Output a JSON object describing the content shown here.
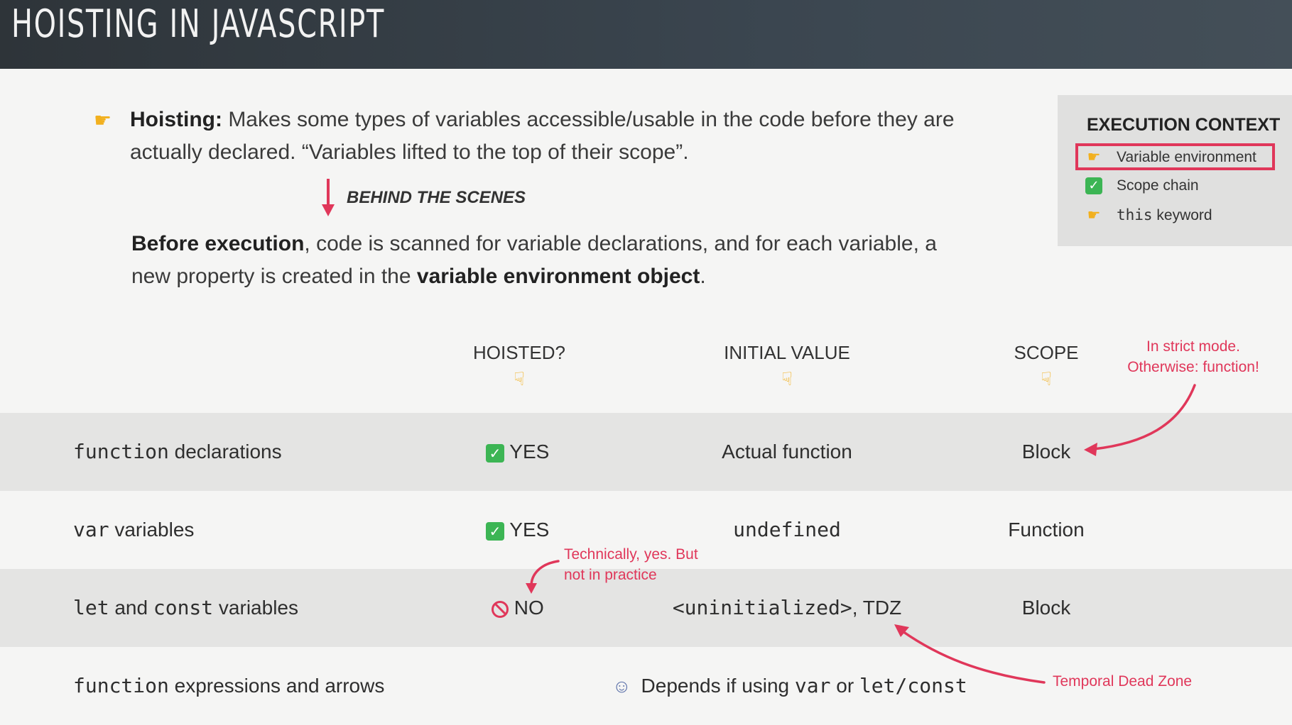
{
  "header": {
    "title": "HOISTING IN JAVASCRIPT"
  },
  "intro": {
    "term": "Hoisting:",
    "text": " Makes some types of variables accessible/usable in the code before they are actually declared. “Variables lifted to the top of their scope”."
  },
  "behind_label": "BEHIND THE SCENES",
  "before": {
    "bold1": "Before execution",
    "text1": ", code is scanned for variable declarations, and for each variable, a new property is created in the ",
    "bold2": "variable environment object",
    "text2": "."
  },
  "execution_context": {
    "title": "EXECUTION CONTEXT",
    "items": [
      {
        "label": "Variable environment",
        "icon": "pointing-hand-icon",
        "highlighted": true
      },
      {
        "label": "Scope chain",
        "icon": "check-icon"
      },
      {
        "label_code": "this",
        "label": " keyword",
        "icon": "pointing-hand-icon"
      }
    ]
  },
  "columns": {
    "hoisted": "HOISTED?",
    "initial": "INITIAL VALUE",
    "scope": "SCOPE"
  },
  "rows": [
    {
      "code": "function",
      "text": " declarations",
      "hoisted": "YES",
      "initial": "Actual function",
      "scope": "Block"
    },
    {
      "code": "var",
      "text": " variables",
      "hoisted": "YES",
      "initial_code": "undefined",
      "scope": "Function"
    },
    {
      "code": "let",
      "mid": " and ",
      "code2": "const",
      "text": " variables",
      "hoisted": "NO",
      "initial_code": "<uninitialized>",
      "initial_suffix": ", TDZ",
      "scope": "Block"
    },
    {
      "code": "function",
      "text": " expressions and arrows",
      "depends_pre": "Depends if using ",
      "depends_code1": "var",
      "depends_mid": " or ",
      "depends_code2": "let/const"
    }
  ],
  "notes": {
    "strict": "In strict mode. Otherwise: function!",
    "technically": "Technically, yes. But not in practice",
    "tdz": "Temporal Dead Zone"
  },
  "colors": {
    "accent": "#e0375a",
    "check": "#3cb554",
    "hand": "#f2b01e"
  }
}
